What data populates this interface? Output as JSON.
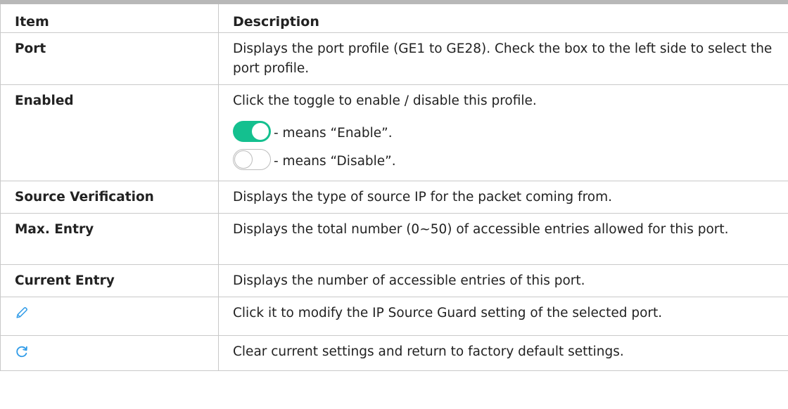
{
  "header": {
    "item": "Item",
    "description": "Description"
  },
  "rows": [
    {
      "item": "Port",
      "description": "Displays the port profile (GE1 to GE28). Check the box to the left side to select the port profile."
    },
    {
      "item": "Enabled",
      "description": "Click the toggle to enable / disable this profile.",
      "toggle_on_text": "- means “Enable”.",
      "toggle_off_text": "- means “Disable”."
    },
    {
      "item": "Source Verification",
      "description": "Displays the type of source IP for the packet coming from."
    },
    {
      "item": "Max. Entry",
      "description": "Displays the total number (0~50) of accessible entries allowed for this port."
    },
    {
      "item": "Current Entry",
      "description": "Displays the number of accessible entries of this port."
    },
    {
      "icon": "pencil-icon",
      "description": "Click it to modify the IP Source Guard setting of the selected port."
    },
    {
      "icon": "refresh-icon",
      "description": "Clear current settings and return to factory default settings."
    }
  ],
  "colors": {
    "toggle_on": "#14c08f",
    "icon_blue": "#2f9be8",
    "border": "#c9c9c9"
  }
}
